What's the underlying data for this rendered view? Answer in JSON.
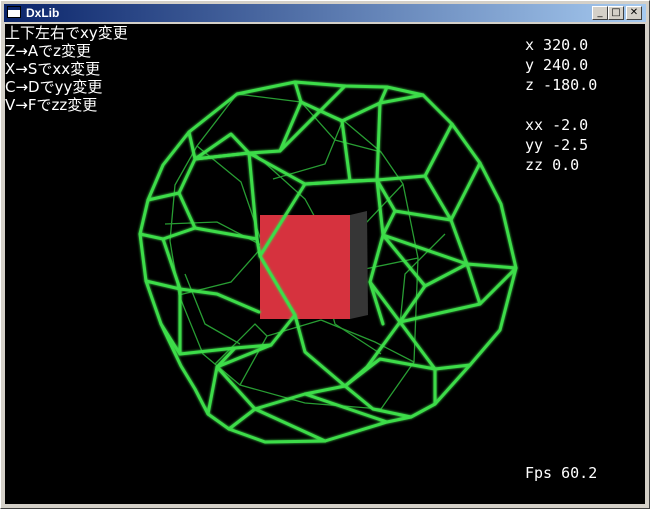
{
  "window": {
    "title": "DxLib",
    "minimize_glyph": "_",
    "maximize_glyph": "□",
    "close_glyph": "✕"
  },
  "instructions": [
    "上下左右でxy変更",
    "Z→Aでz変更",
    "X→Sでxx変更",
    "C→Dでyy変更",
    "V→Fでzz変更"
  ],
  "stats": {
    "x": "x 320.0",
    "y": "y 240.0",
    "z": "z -180.0",
    "xx": "xx -2.0",
    "yy": "yy -2.5",
    "zz": "zz 0.0"
  },
  "fps": "Fps 60.2",
  "scene": {
    "background": "#000000",
    "wireframe_color": "#3ddc4a",
    "cube_front_color": "#d6323e",
    "cube_side_color": "#363636"
  }
}
